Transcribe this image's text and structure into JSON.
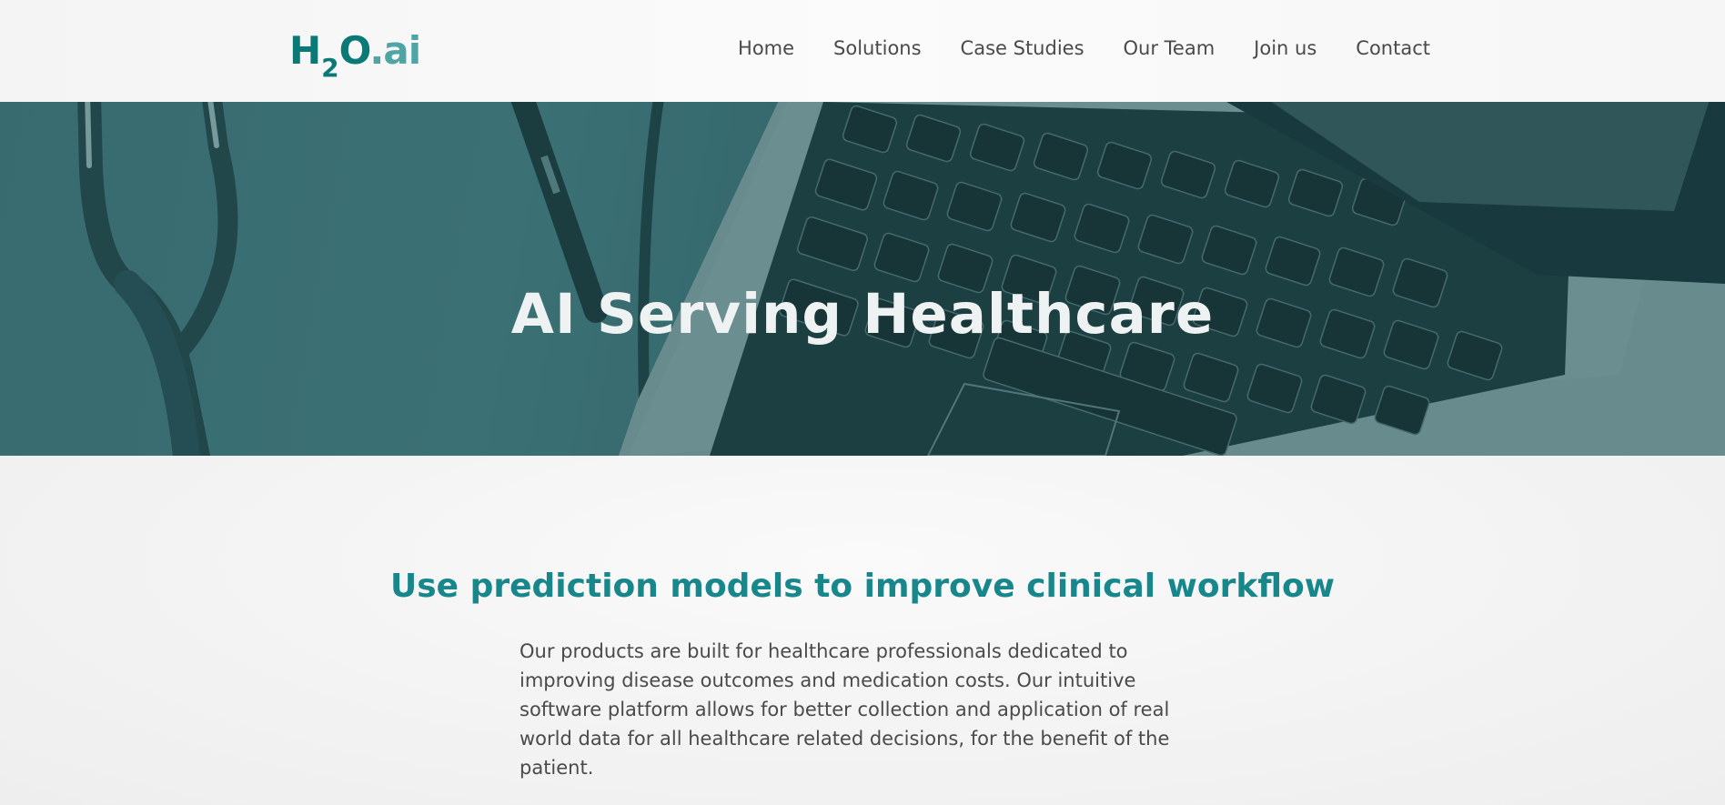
{
  "header": {
    "logo": {
      "main": "H",
      "sub": "2",
      "o": "O",
      "ai": ".ai"
    },
    "nav": [
      "Home",
      "Solutions",
      "Case Studies",
      "Our Team",
      "Join us",
      "Contact"
    ]
  },
  "hero": {
    "title": "AI Serving Healthcare",
    "image": "stethoscope-pen-laptop-photo"
  },
  "main": {
    "heading": "Use prediction models to improve clinical workflow",
    "paragraph": "Our products are built for healthcare professionals dedicated to improving disease outcomes and medication costs. Our intuitive software platform allows for better collection and application of real world data for all healthcare related decisions, for the benefit of the patient."
  },
  "colors": {
    "brand_teal": "#0b7a76",
    "brand_light_teal": "#4fa5a5",
    "heading_teal": "#17878c",
    "hero_overlay": "#3b6b70"
  }
}
